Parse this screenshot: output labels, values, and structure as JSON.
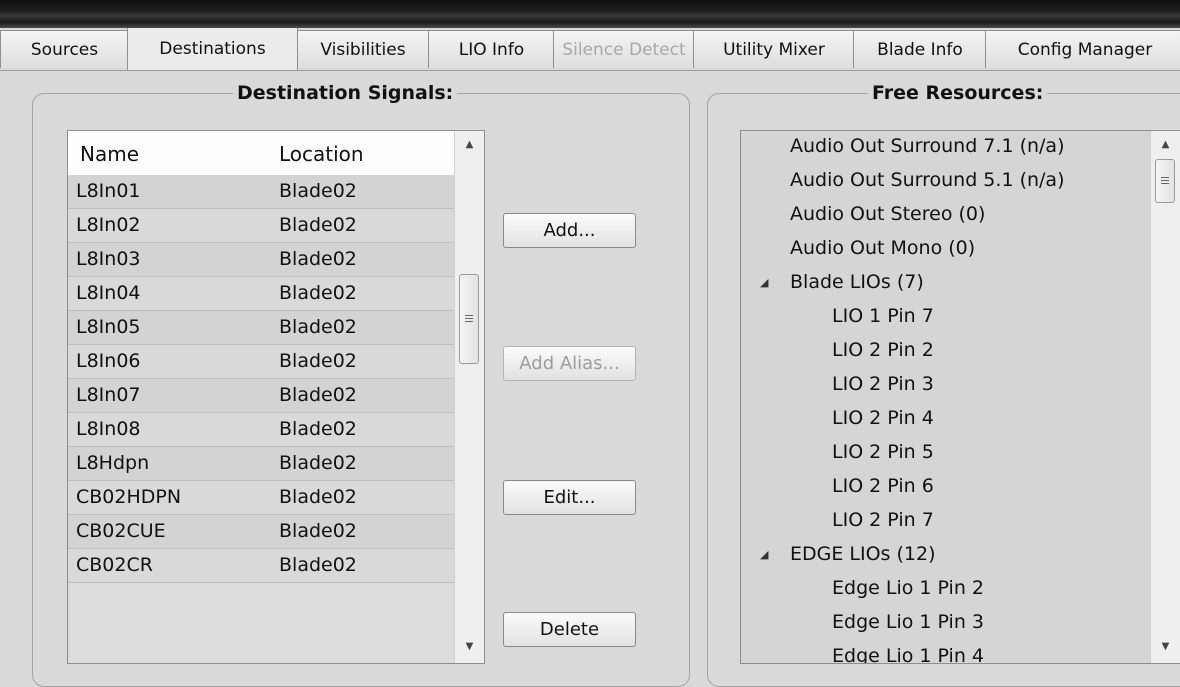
{
  "tabs": [
    {
      "label": "Sources",
      "state": "normal"
    },
    {
      "label": "Destinations",
      "state": "active"
    },
    {
      "label": "Visibilities",
      "state": "normal"
    },
    {
      "label": "LIO Info",
      "state": "normal"
    },
    {
      "label": "Silence Detect",
      "state": "disabled"
    },
    {
      "label": "Utility Mixer",
      "state": "normal"
    },
    {
      "label": "Blade Info",
      "state": "normal"
    },
    {
      "label": "Config Manager",
      "state": "normal"
    }
  ],
  "destinations": {
    "title": "Destination Signals:",
    "columns": [
      "Name",
      "Location"
    ],
    "rows": [
      [
        "L8In01",
        "Blade02"
      ],
      [
        "L8In02",
        "Blade02"
      ],
      [
        "L8In03",
        "Blade02"
      ],
      [
        "L8In04",
        "Blade02"
      ],
      [
        "L8In05",
        "Blade02"
      ],
      [
        "L8In06",
        "Blade02"
      ],
      [
        "L8In07",
        "Blade02"
      ],
      [
        "L8In08",
        "Blade02"
      ],
      [
        "L8Hdpn",
        "Blade02"
      ],
      [
        "CB02HDPN",
        "Blade02"
      ],
      [
        "CB02CUE",
        "Blade02"
      ],
      [
        "CB02CR",
        "Blade02"
      ]
    ]
  },
  "buttons": {
    "add": "Add...",
    "add_alias": "Add Alias...",
    "edit": "Edit...",
    "delete": "Delete"
  },
  "resources": {
    "title": "Free Resources:",
    "items": [
      {
        "label": "Audio Out Surround 7.1 (n/a)",
        "level": 0,
        "expander": false
      },
      {
        "label": "Audio Out Surround 5.1 (n/a)",
        "level": 0,
        "expander": false
      },
      {
        "label": "Audio Out Stereo (0)",
        "level": 0,
        "expander": false
      },
      {
        "label": "Audio Out Mono (0)",
        "level": 0,
        "expander": false
      },
      {
        "label": "Blade LIOs (7)",
        "level": 0,
        "expander": true
      },
      {
        "label": "LIO 1 Pin 7",
        "level": 1,
        "expander": false
      },
      {
        "label": "LIO 2 Pin 2",
        "level": 1,
        "expander": false
      },
      {
        "label": "LIO 2 Pin 3",
        "level": 1,
        "expander": false
      },
      {
        "label": "LIO 2 Pin 4",
        "level": 1,
        "expander": false
      },
      {
        "label": "LIO 2 Pin 5",
        "level": 1,
        "expander": false
      },
      {
        "label": "LIO 2 Pin 6",
        "level": 1,
        "expander": false
      },
      {
        "label": "LIO 2 Pin 7",
        "level": 1,
        "expander": false
      },
      {
        "label": "EDGE LIOs (12)",
        "level": 0,
        "expander": true
      },
      {
        "label": "Edge Lio 1 Pin 2",
        "level": 1,
        "expander": false
      },
      {
        "label": "Edge Lio 1 Pin 3",
        "level": 1,
        "expander": false
      },
      {
        "label": "Edge Lio 1 Pin 4",
        "level": 1,
        "expander": false
      }
    ]
  },
  "icons": {
    "scroll_up": "▲",
    "scroll_down": "▼",
    "expanded": "◢"
  }
}
